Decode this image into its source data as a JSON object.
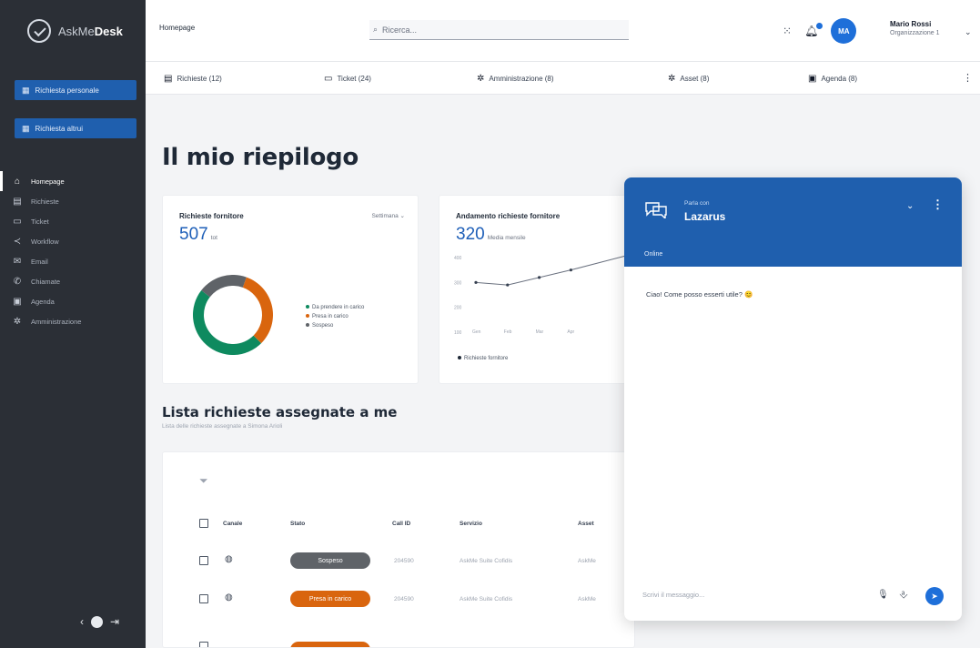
{
  "app": {
    "name_prefix": "AskMe",
    "name_bold": "Desk"
  },
  "sidebar": {
    "buttons": [
      {
        "label": "Richiesta personale",
        "icon": "grid-icon"
      },
      {
        "label": "Richiesta altrui",
        "icon": "grid-icon"
      }
    ],
    "items": [
      {
        "label": "Homepage",
        "icon": "home-icon",
        "active": true
      },
      {
        "label": "Richieste",
        "icon": "list-icon"
      },
      {
        "label": "Ticket",
        "icon": "ticket-icon"
      },
      {
        "label": "Workflow",
        "icon": "share-icon"
      },
      {
        "label": "Email",
        "icon": "mail-icon"
      },
      {
        "label": "Chiamate",
        "icon": "phone-icon"
      },
      {
        "label": "Agenda",
        "icon": "calendar-icon"
      },
      {
        "label": "Amministrazione",
        "icon": "gear-icon"
      }
    ]
  },
  "topbar": {
    "breadcrumb": "Homepage",
    "search_placeholder": "Ricerca...",
    "user_initials": "MA",
    "user_name": "Mario Rossi",
    "user_org": "Organizzazione 1"
  },
  "tabs": [
    {
      "label": "Richieste (12)",
      "icon": "list-icon"
    },
    {
      "label": "Ticket (24)",
      "icon": "ticket-icon"
    },
    {
      "label": "Amministrazione (8)",
      "icon": "gear-icon"
    },
    {
      "label": "Asset (8)",
      "icon": "gear-icon"
    },
    {
      "label": "Agenda (8)",
      "icon": "calendar-icon"
    }
  ],
  "main": {
    "title": "Il mio riepilogo",
    "card1": {
      "title": "Richieste fornitore",
      "dropdown": "Settimana",
      "value": "507",
      "unit": "tot"
    },
    "card2": {
      "title": "Andamento richieste fornitore",
      "value": "320",
      "unit": "Media mensile",
      "legend": "Richieste fornitore"
    },
    "list_title": "Lista richieste assegnate a me",
    "list_subtitle": "Lista delle richieste assegnate a Simona Arioli",
    "table": {
      "headers": [
        "Canale",
        "Stato",
        "Call ID",
        "Servizio",
        "Asset"
      ],
      "rows": [
        {
          "stato": "Sospeso",
          "stato_color": "#5f6368",
          "call_id": "204590",
          "servizio": "AskMe Suite Cofidis",
          "asset": "AskMe"
        },
        {
          "stato": "Presa in carico",
          "stato_color": "#d9650e",
          "call_id": "204590",
          "servizio": "AskMe Suite Cofidis",
          "asset": "AskMe"
        },
        {
          "stato": "",
          "stato_color": "#d9650e",
          "call_id": "",
          "servizio": "",
          "asset": ""
        }
      ]
    }
  },
  "chart_data": {
    "type": "pie",
    "title": "Richieste fornitore",
    "categories": [
      "Da prendere in carico",
      "Presa in carico",
      "Sospeso"
    ],
    "values": [
      48,
      32,
      20
    ],
    "colors": [
      "#0e8a5f",
      "#d9650e",
      "#5f6368"
    ]
  },
  "line_chart": {
    "type": "line",
    "categories": [
      "Gen",
      "Feb",
      "Mar",
      "Apr"
    ],
    "y_ticks": [
      "400",
      "300",
      "200",
      "100"
    ],
    "values": [
      300,
      290,
      320,
      350
    ]
  },
  "chat": {
    "sub": "Parla con",
    "name": "Lazarus",
    "status": "Online",
    "message": "Ciao! Come posso esserti utile? 😊",
    "input_placeholder": "Scrivi il messaggio..."
  },
  "colors": {
    "primary": "#1f5fae",
    "accent": "#1e6fd9",
    "sidebar": "#2b2f36",
    "orange": "#d9650e",
    "green": "#0e8a5f",
    "grey": "#5f6368"
  }
}
